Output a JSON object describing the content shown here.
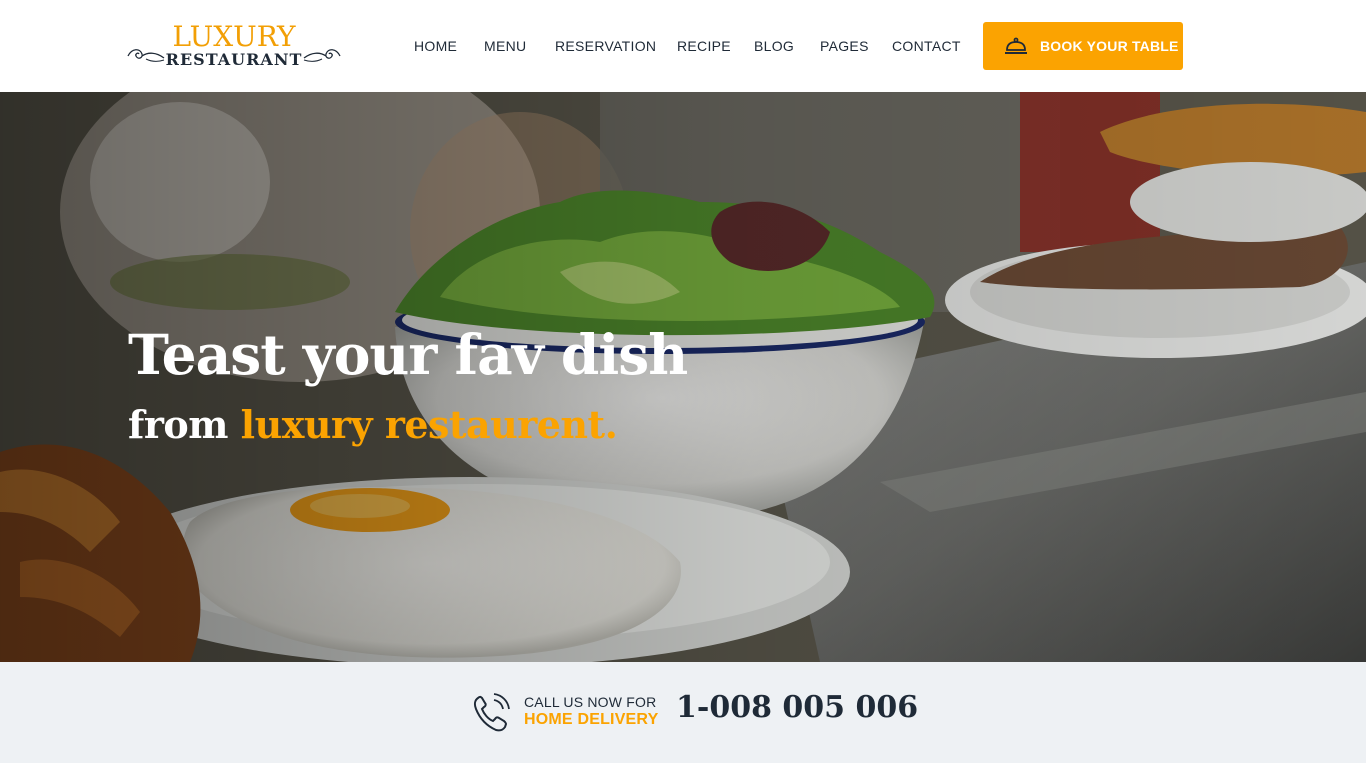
{
  "brand": {
    "name_line1": "LUXURY",
    "name_line2": "RESTAURANT"
  },
  "nav": {
    "items": [
      {
        "label": "HOME"
      },
      {
        "label": "MENU"
      },
      {
        "label": "RESERVATION"
      },
      {
        "label": "RECIPE"
      },
      {
        "label": "BLOG"
      },
      {
        "label": "PAGES"
      },
      {
        "label": "CONTACT"
      }
    ]
  },
  "cta": {
    "label": "BOOK YOUR TABLE",
    "icon": "service-bell-icon"
  },
  "hero": {
    "title": "Teast your fav dish",
    "subtitle_prefix": "from ",
    "subtitle_accent": "luxury restaurent."
  },
  "delivery": {
    "icon": "phone-icon",
    "line1": "CALL US NOW FOR",
    "line2": "HOME DELIVERY",
    "phone": "1-008 005 006"
  },
  "colors": {
    "accent": "#fba301",
    "text_dark": "#1f2a37",
    "strip_bg": "#eef1f4"
  }
}
